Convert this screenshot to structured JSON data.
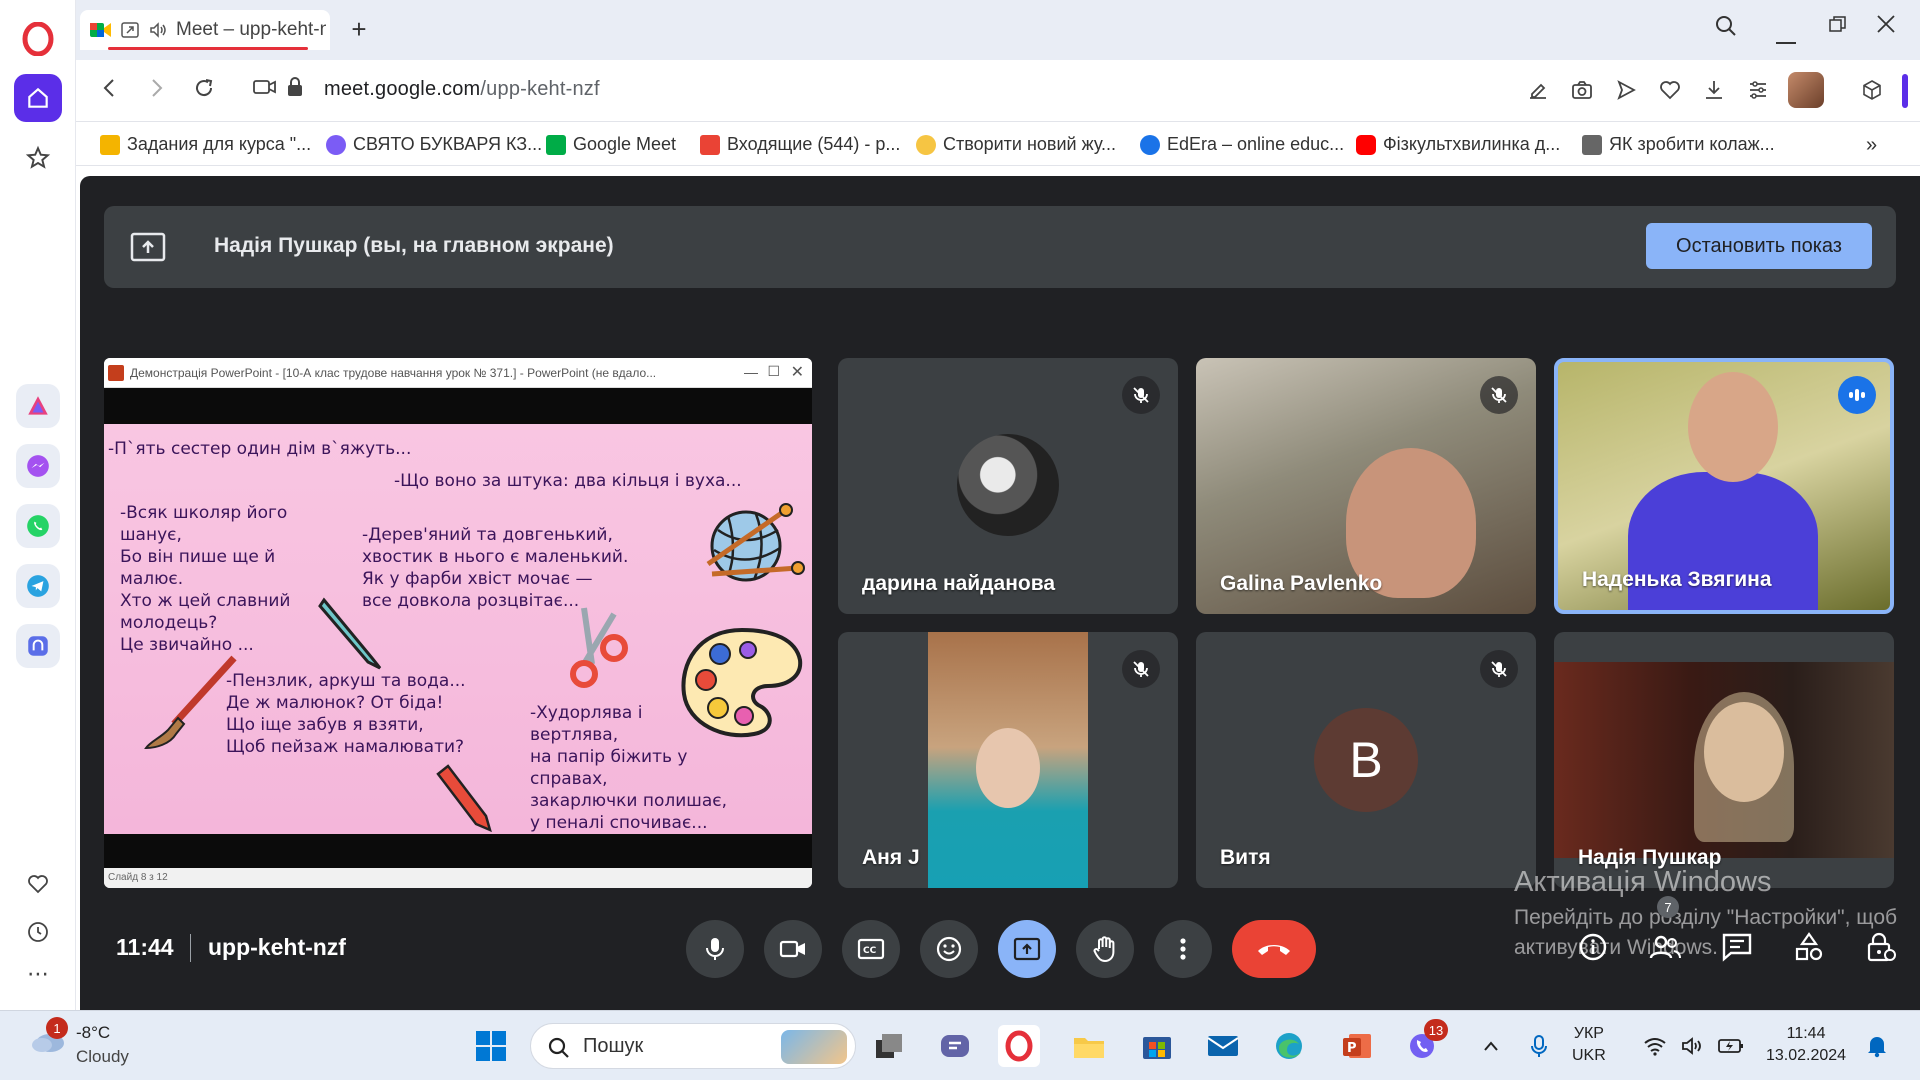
{
  "browser": {
    "tab_title": "Meet – upp-keht-n",
    "url_domain": "meet.google.com",
    "url_path": "/upp-keht-nzf",
    "bookmarks": [
      "Задания для курса \"...",
      "СВЯТО БУКВАРЯ КЗ...",
      "Google Meet",
      "Входящие (544) - p...",
      "Створити новий жу...",
      "EdEra – online educ...",
      "Фізкультхвилинка д...",
      "ЯК зробити колаж..."
    ]
  },
  "meet": {
    "presenting_text": "Надія Пушкар (вы, на главном экране)",
    "stop_button": "Остановить показ",
    "time": "11:44",
    "meeting_code": "upp-keht-nzf",
    "people_count": "7",
    "participants": [
      {
        "name": "дарина найданова",
        "muted": true
      },
      {
        "name": "Galina Pavlenko",
        "muted": true
      },
      {
        "name": "Наденька Звягина",
        "muted": false,
        "speaking": true
      },
      {
        "name": "Аня J",
        "muted": true
      },
      {
        "name": "Витя",
        "muted": true,
        "initial": "В"
      },
      {
        "name": "Надія Пушкар",
        "muted": false
      }
    ]
  },
  "slide": {
    "window_title": "Демонстрація PowerPoint - [10-А клас трудове навчання урок № 371.] - PowerPoint (не вдало...",
    "status": "Слайд 8 з 12",
    "riddle1": "-П`ять сестер один дім в`яжуть...",
    "riddle2": "-Що воно за штука: два кільця і вуха...",
    "riddle3": "-Всяк школяр його\nшанує,\nБо він пише ще й\nмалює.\nХто ж цей славний\nмолодець?\nЦе звичайно ...",
    "riddle4": "-Дерев'яний та довгенький,\nхвостик в нього є маленький.\nЯк у фарби хвіст мочає —\nвсе довкола розцвітає...",
    "riddle5": "-Пензлик, аркуш та вода...\nДе ж малюнок? От біда!\nЩо іще забув я взяти,\nЩоб пейзаж намалювати?",
    "riddle6": "-Худорлява і\nвертлява,\nна папір біжить у\nсправах,\nзакарлючки полишає,\nу пеналі спочиває..."
  },
  "windows": {
    "activation_title": "Активація Windows",
    "activation_text": "Перейдіть до розділу \"Настройки\", щоб\nактивувати Windows.",
    "weather_temp": "-8°C",
    "weather_cond": "Cloudy",
    "weather_badge": "1",
    "search_placeholder": "Пошук",
    "viber_badge": "13",
    "lang_top": "УКР",
    "lang_bottom": "UKR",
    "clock_time": "11:44",
    "clock_date": "13.02.2024"
  },
  "colors": {
    "meet_bg": "#202124",
    "tile_bg": "#3c4043",
    "accent_blue": "#8ab4f8",
    "end_call_red": "#ea4335",
    "opera_red": "#e5303a",
    "opera_home": "#5b2ee8"
  }
}
